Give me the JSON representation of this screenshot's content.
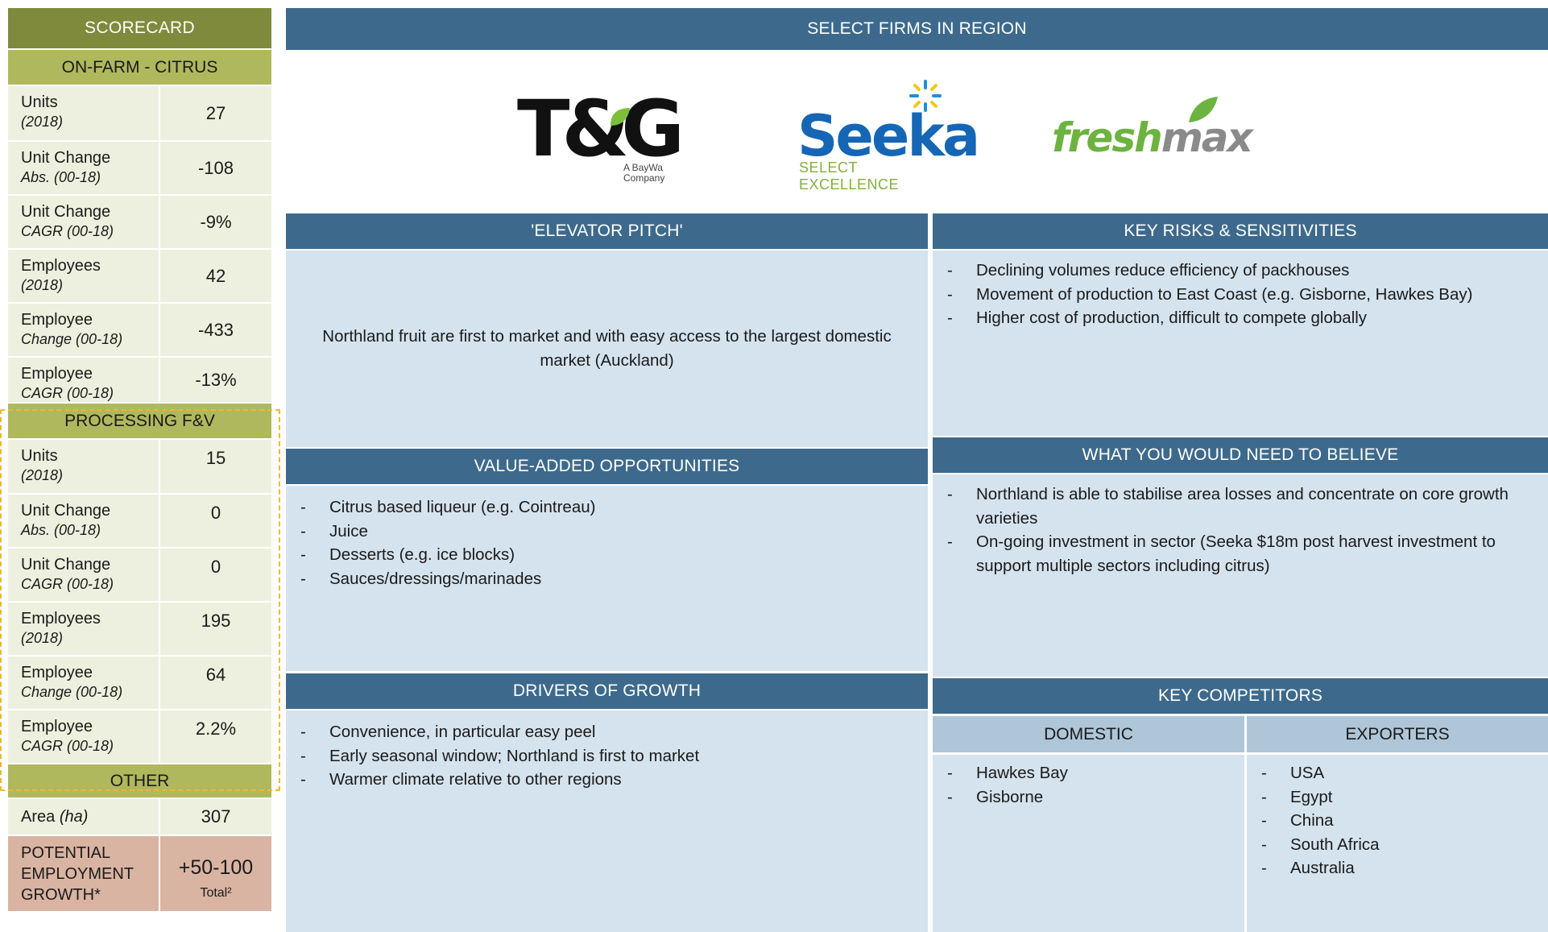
{
  "scorecard": {
    "title": "SCORECARD",
    "onfarm": {
      "title": "ON-FARM - CITRUS",
      "rows": [
        {
          "label": "Units",
          "sub": "(2018)",
          "value": "27"
        },
        {
          "label": "Unit Change",
          "sub": "Abs. (00-18)",
          "value": "-108"
        },
        {
          "label": "Unit Change",
          "sub": "CAGR (00-18)",
          "value": "-9%"
        },
        {
          "label": "Employees",
          "sub": "(2018)",
          "value": "42"
        },
        {
          "label": "Employee",
          "sub": "Change (00-18)",
          "value": "-433"
        },
        {
          "label": "Employee",
          "sub": "CAGR (00-18)",
          "value": "-13%"
        }
      ]
    },
    "processing": {
      "title": "PROCESSING F&V",
      "rows": [
        {
          "label": "Units",
          "sub": "(2018)",
          "value": "15"
        },
        {
          "label": "Unit Change",
          "sub": "Abs. (00-18)",
          "value": "0"
        },
        {
          "label": "Unit Change",
          "sub": "CAGR (00-18)",
          "value": "0"
        },
        {
          "label": "Employees",
          "sub": "(2018)",
          "value": "195"
        },
        {
          "label": "Employee",
          "sub": "Change (00-18)",
          "value": "64"
        },
        {
          "label": "Employee",
          "sub": "CAGR (00-18)",
          "value": "2.2%"
        }
      ]
    },
    "other": {
      "title": "OTHER",
      "area_label": "Area ",
      "area_unit": "(ha)",
      "area_value": "307",
      "potential_label": "POTENTIAL EMPLOYMENT GROWTH*",
      "potential_value": "+50-100",
      "potential_note": "Total²"
    }
  },
  "firms": {
    "title": "SELECT FIRMS IN REGION",
    "logos": {
      "tg": "T&G",
      "tg_sub": "A BayWa Company",
      "seeka": "Seeka",
      "seeka_sub": "SELECT EXCELLENCE",
      "fresh_a": "fresh",
      "fresh_b": "max"
    }
  },
  "pitch": {
    "title": "'ELEVATOR PITCH'",
    "text": "Northland fruit are first to market and with easy access to the largest domestic market (Auckland)"
  },
  "risks": {
    "title": "KEY RISKS & SENSITIVITIES",
    "items": [
      "Declining volumes reduce efficiency of packhouses",
      "Movement of production to East Coast (e.g. Gisborne, Hawkes Bay)",
      "Higher cost of production, difficult to compete globally"
    ]
  },
  "value_added": {
    "title": "VALUE-ADDED OPPORTUNITIES",
    "items": [
      "Citrus based liqueur (e.g. Cointreau)",
      "Juice",
      "Desserts (e.g. ice blocks)",
      "Sauces/dressings/marinades"
    ]
  },
  "believe": {
    "title": "WHAT YOU WOULD NEED TO BELIEVE",
    "items": [
      "Northland is able to stabilise area losses and concentrate on core growth varieties",
      "On-going investment in sector (Seeka $18m post harvest investment to support multiple sectors including citrus)"
    ]
  },
  "drivers": {
    "title": "DRIVERS OF GROWTH",
    "items": [
      "Convenience, in particular easy peel",
      "Early seasonal window; Northland is first to market",
      "Warmer climate relative to other regions"
    ]
  },
  "competitors": {
    "title": "KEY COMPETITORS",
    "domestic_title": "DOMESTIC",
    "domestic": [
      "Hawkes Bay",
      "Gisborne"
    ],
    "exporters_title": "EXPORTERS",
    "exporters": [
      "USA",
      "Egypt",
      "China",
      "South Africa",
      "Australia"
    ]
  },
  "colors": {
    "header_blue": "#3d6a8c",
    "panel_blue": "#d5e3ee",
    "olive_dark": "#7f8a3c",
    "olive_light": "#b0b85e",
    "highlight": "#f5b52a",
    "potential": "#d9b4a2"
  }
}
